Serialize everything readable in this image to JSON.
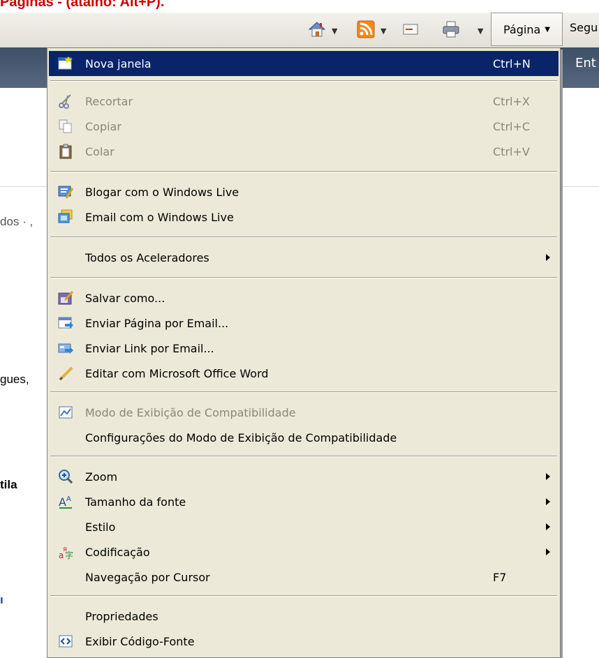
{
  "heading_fragment": "Páginas - (atalho: Alt+P).",
  "toolbar": {
    "pagina_label": "Página",
    "seguranca_fragment": "Segu"
  },
  "banner_fragment": "Ent",
  "left_fragments": {
    "f1": "dos · ,",
    "f2": "gues,",
    "f3": "tila",
    "f4": "ı"
  },
  "menu": {
    "nova_janela": {
      "label": "Nova janela",
      "shortcut": "Ctrl+N"
    },
    "recortar": {
      "label": "Recortar",
      "shortcut": "Ctrl+X"
    },
    "copiar": {
      "label": "Copiar",
      "shortcut": "Ctrl+C"
    },
    "colar": {
      "label": "Colar",
      "shortcut": "Ctrl+V"
    },
    "blogar": {
      "label": "Blogar com o Windows Live"
    },
    "email_live": {
      "label": "Email com o Windows Live"
    },
    "aceleradores": {
      "label": "Todos os Aceleradores"
    },
    "salvar": {
      "label": "Salvar como..."
    },
    "enviar_pagina": {
      "label": "Enviar Página por Email..."
    },
    "enviar_link": {
      "label": "Enviar Link por Email..."
    },
    "editar_word": {
      "label": "Editar com Microsoft Office Word"
    },
    "modo_compat": {
      "label": "Modo de Exibição de Compatibilidade"
    },
    "config_compat": {
      "label": "Configurações do Modo de Exibição de Compatibilidade"
    },
    "zoom": {
      "label": "Zoom"
    },
    "tamanho_fonte": {
      "label": "Tamanho da fonte"
    },
    "estilo": {
      "label": "Estilo"
    },
    "codificacao": {
      "label": "Codificação"
    },
    "navegacao_cursor": {
      "label": "Navegação por Cursor",
      "shortcut": "F7"
    },
    "propriedades": {
      "label": "Propriedades"
    },
    "exibir_codigo": {
      "label": "Exibir Código-Fonte"
    }
  },
  "colors": {
    "selected_bg": "#0a246a",
    "menu_bg": "#ece9d8",
    "heading_red": "#cc0000"
  }
}
